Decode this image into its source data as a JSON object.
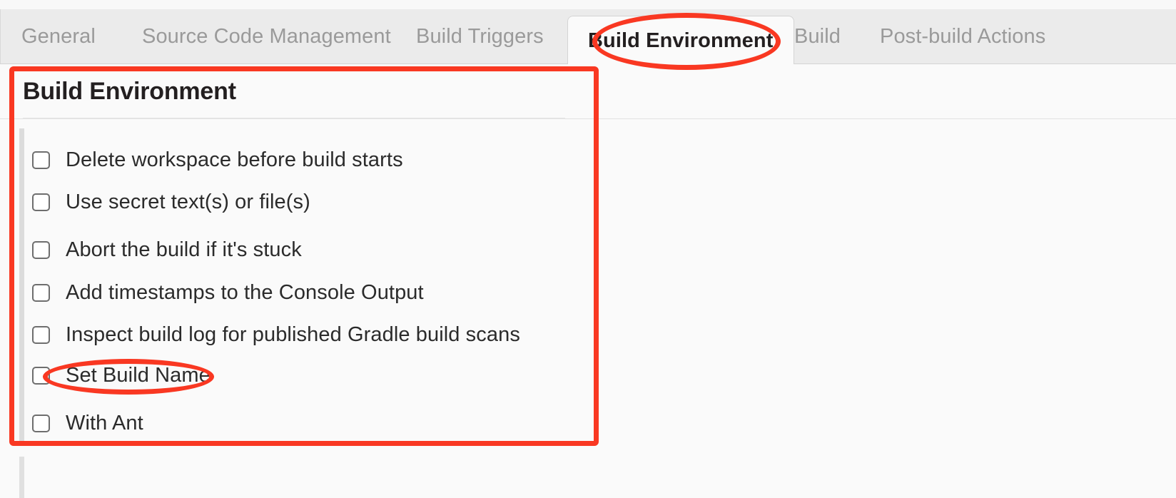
{
  "tabs": [
    {
      "label": "General",
      "active": false
    },
    {
      "label": "Source Code Management",
      "active": false
    },
    {
      "label": "Build Triggers",
      "active": false
    },
    {
      "label": "Build Environment",
      "active": true
    },
    {
      "label": "Build",
      "active": false
    },
    {
      "label": "Post-build Actions",
      "active": false
    }
  ],
  "section": {
    "heading": "Build Environment"
  },
  "checkboxes": [
    {
      "label": "Delete workspace before build starts",
      "checked": false
    },
    {
      "label": "Use secret text(s) or file(s)",
      "checked": false
    },
    {
      "label": "Abort the build if it's stuck",
      "checked": false
    },
    {
      "label": "Add timestamps to the Console Output",
      "checked": false
    },
    {
      "label": "Inspect build log for published Gradle build scans",
      "checked": false
    },
    {
      "label": "Set Build Name",
      "checked": false
    },
    {
      "label": "With Ant",
      "checked": false
    }
  ],
  "annotations": {
    "color": "#f93822",
    "items": [
      {
        "kind": "ellipse",
        "target": "tab-build-environment"
      },
      {
        "kind": "rect",
        "target": "build-environment-panel"
      },
      {
        "kind": "ellipse",
        "target": "checkbox-set-build-name"
      }
    ]
  }
}
